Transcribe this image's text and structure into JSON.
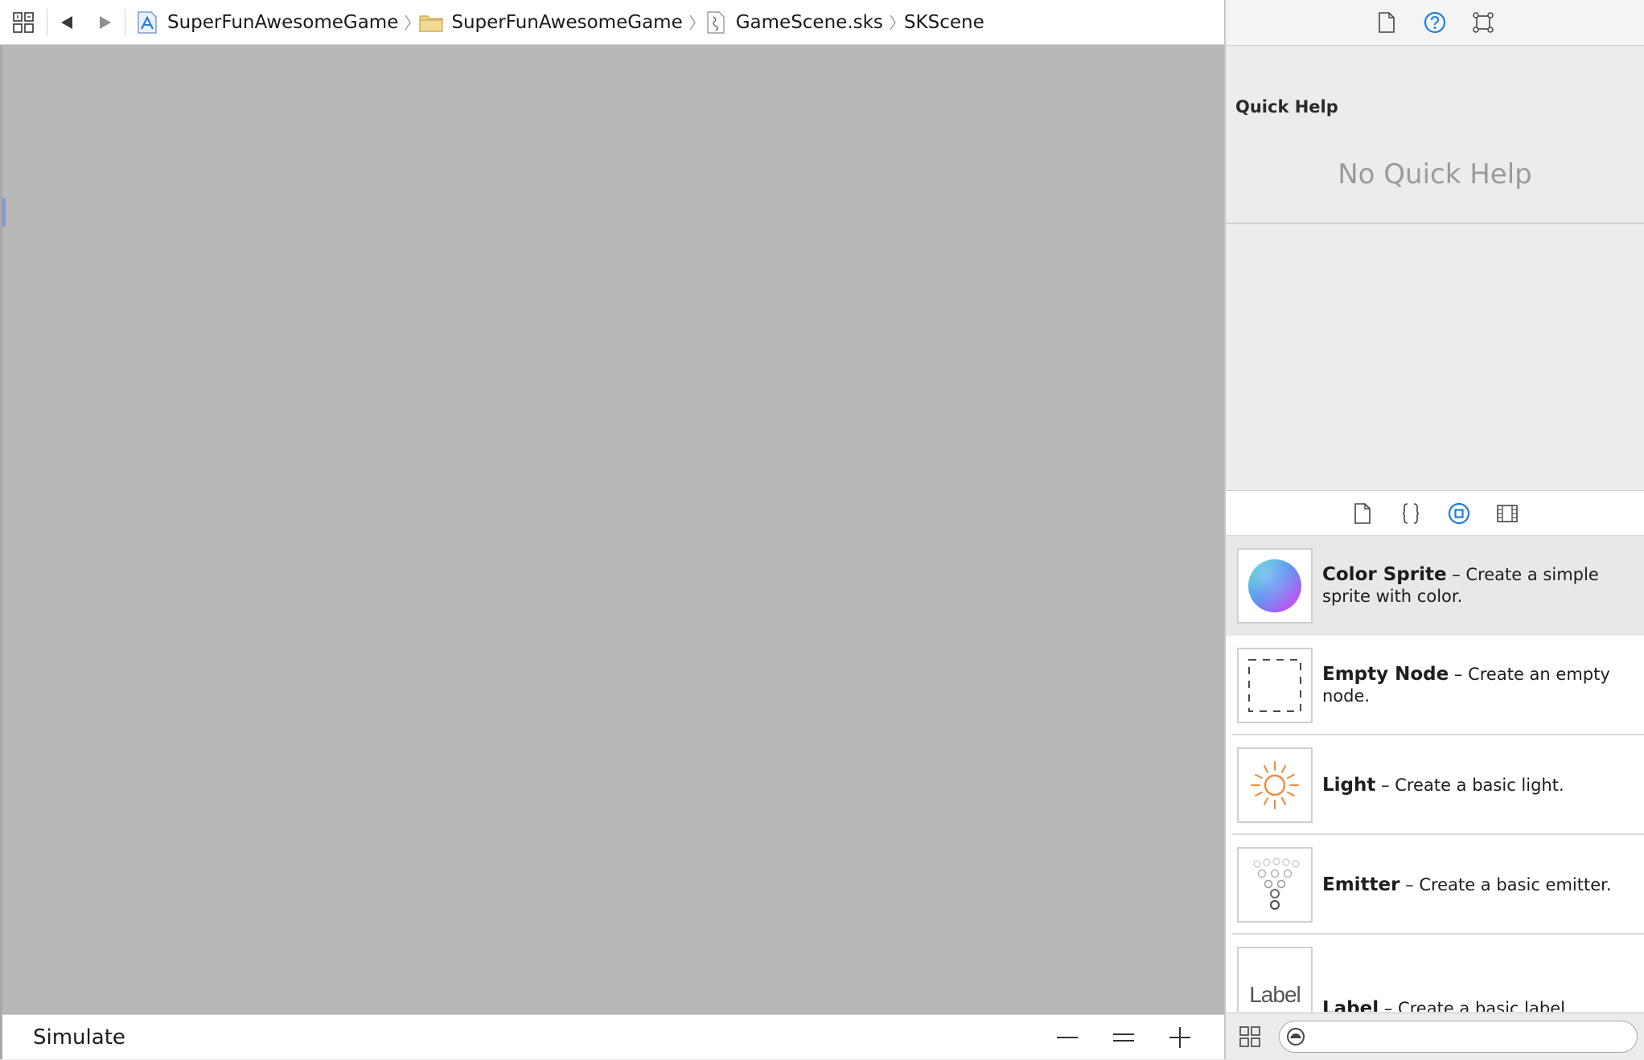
{
  "jumpbar": {
    "breadcrumbs": [
      {
        "label": "SuperFunAwesomeGame",
        "icon": "xcode-project-icon"
      },
      {
        "label": "SuperFunAwesomeGame",
        "icon": "folder-icon"
      },
      {
        "label": "GameScene.sks",
        "icon": "sks-file-icon"
      },
      {
        "label": "SKScene",
        "icon": ""
      }
    ]
  },
  "editor": {
    "canvas_color": "#b8b8b8",
    "simulate_label": "Simulate",
    "zoom_out_label": "—",
    "zoom_actual_label": "=",
    "zoom_in_label": "+"
  },
  "inspector": {
    "quick_help": {
      "title": "Quick Help",
      "empty_message": "No Quick Help"
    },
    "library": {
      "items": [
        {
          "name": "Color Sprite",
          "description": " – Create a simple sprite with color.",
          "icon": "color-sprite-icon",
          "selected": true
        },
        {
          "name": "Empty Node",
          "description": " – Create an empty node.",
          "icon": "empty-node-icon"
        },
        {
          "name": "Light",
          "description": " – Create a basic light.",
          "icon": "light-icon"
        },
        {
          "name": "Emitter",
          "description": " – Create a basic emitter.",
          "icon": "emitter-icon"
        },
        {
          "name": "Label",
          "description": " – Create a basic label.",
          "icon": "label-icon",
          "thumb_text": "Label"
        }
      ]
    },
    "filter": {
      "placeholder": ""
    }
  },
  "colors": {
    "accent": "#1f7ddb",
    "light_orange": "#f08a3a"
  }
}
